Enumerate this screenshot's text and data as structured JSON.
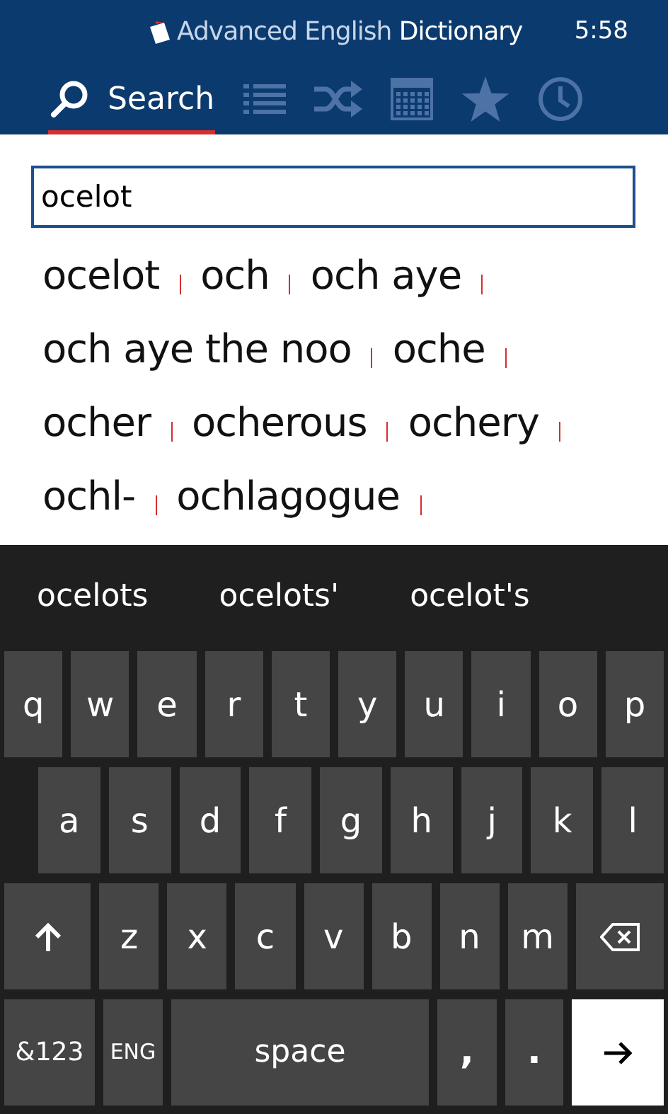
{
  "header": {
    "title": "Advanced English **Dictionary**",
    "time": "5:58"
  },
  "tabs": [
    {
      "kind": "search",
      "label": "Search",
      "selected": true
    },
    {
      "kind": "list",
      "selected": false
    },
    {
      "kind": "shuffle",
      "selected": false
    },
    {
      "kind": "calendar",
      "selected": false
    },
    {
      "kind": "star",
      "selected": false
    },
    {
      "kind": "history",
      "selected": false
    }
  ],
  "search": {
    "value": "ocelot"
  },
  "result_rows": [
    [
      "ocelot",
      "och",
      "och aye"
    ],
    [
      "och aye the noo",
      "oche"
    ],
    [
      "ocher",
      "ocherous",
      "ochery"
    ],
    [
      "ochl-",
      "ochlagogue"
    ]
  ],
  "keyboard": {
    "suggestions": [
      "ocelots",
      "ocelots'",
      "ocelot's"
    ],
    "letter_row": [
      {
        "kind": "letter",
        "label": "q"
      },
      {
        "kind": "letter",
        "label": "w"
      },
      {
        "kind": "letter",
        "label": "e"
      },
      {
        "kind": "letter",
        "label": "r"
      },
      {
        "kind": "letter",
        "label": "t"
      },
      {
        "kind": "letter",
        "label": "y"
      },
      {
        "kind": "letter",
        "label": "u"
      },
      {
        "kind": "letter",
        "label": "i"
      },
      {
        "kind": "letter",
        "label": "o"
      },
      {
        "kind": "letter",
        "label": "p"
      }
    ],
    "home_row": [
      {
        "kind": "letter",
        "label": "a"
      },
      {
        "kind": "letter",
        "label": "s"
      },
      {
        "kind": "letter",
        "label": "d"
      },
      {
        "kind": "letter",
        "label": "f"
      },
      {
        "kind": "letter",
        "label": "g"
      },
      {
        "kind": "letter",
        "label": "h"
      },
      {
        "kind": "letter",
        "label": "j"
      },
      {
        "kind": "letter",
        "label": "k"
      },
      {
        "kind": "letter",
        "label": "l"
      }
    ],
    "shift_row": [
      {
        "kind": "shift"
      },
      {
        "kind": "letter",
        "label": "z"
      },
      {
        "kind": "letter",
        "label": "x"
      },
      {
        "kind": "letter",
        "label": "c"
      },
      {
        "kind": "letter",
        "label": "v"
      },
      {
        "kind": "letter",
        "label": "b"
      },
      {
        "kind": "letter",
        "label": "n"
      },
      {
        "kind": "letter",
        "label": "m"
      },
      {
        "kind": "backspace"
      }
    ],
    "space_row": [
      {
        "kind": "symbols",
        "label": "&123"
      },
      {
        "kind": "language",
        "label": "ENG"
      },
      {
        "kind": "space",
        "label": "space"
      },
      {
        "kind": "comma",
        "label": ","
      },
      {
        "kind": "period",
        "label": "."
      },
      {
        "kind": "enter"
      }
    ]
  }
}
